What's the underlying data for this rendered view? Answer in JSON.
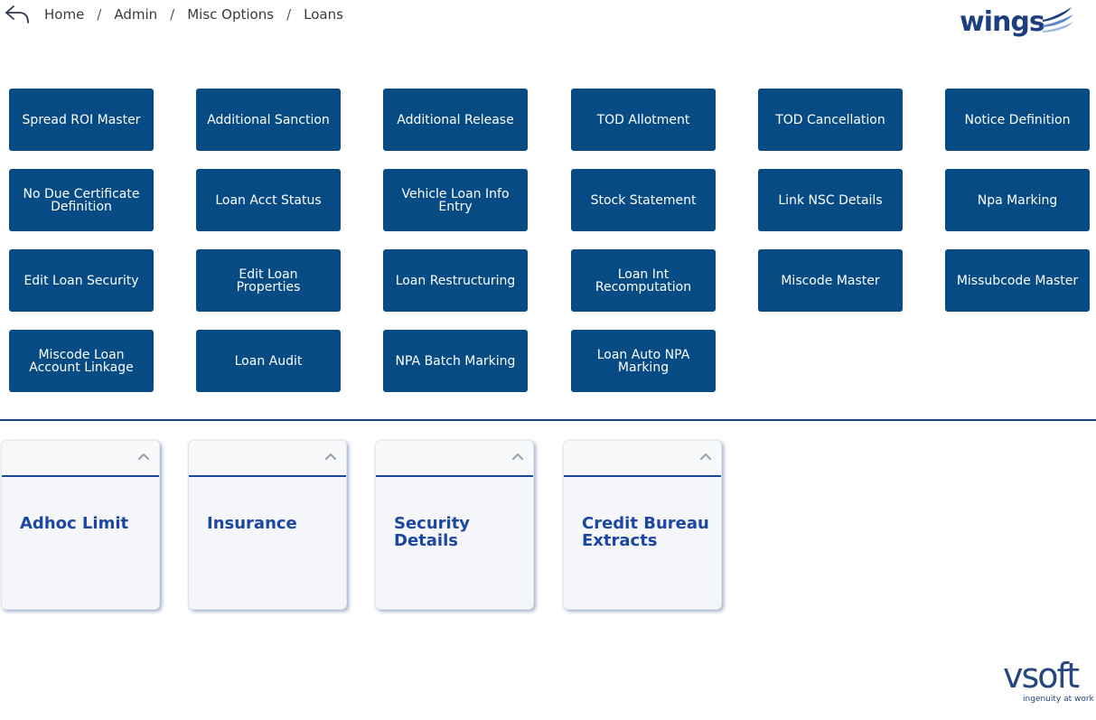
{
  "breadcrumb": [
    "Home",
    "Admin",
    "Misc Options",
    "Loans"
  ],
  "brand": {
    "logo": "wings",
    "footer_logo": "vsoft",
    "footer_tagline": "ingenuity at work"
  },
  "colors": {
    "tile": "#064b84",
    "card_title": "#1c47a0",
    "divider": "#1b3f78",
    "brand": "#1e3f7f"
  },
  "icons": {
    "back": "back-arrow-icon",
    "collapse": "chevron-up-icon"
  },
  "tiles": [
    "Spread ROI Master",
    "Additional Sanction",
    "Additional Release",
    "TOD Allotment",
    "TOD Cancellation",
    "Notice Definition",
    "No Due Certificate Definition",
    "Loan Acct Status",
    "Vehicle Loan Info Entry",
    "Stock Statement",
    "Link NSC Details",
    "Npa Marking",
    "Edit Loan Security",
    "Edit Loan Properties",
    "Loan Restructuring",
    "Loan Int Recomputation",
    "Miscode Master",
    "Missubcode Master",
    "Miscode Loan Account Linkage",
    "Loan Audit",
    "NPA Batch Marking",
    "Loan Auto NPA Marking"
  ],
  "cards": [
    "Adhoc Limit",
    "Insurance",
    "Security Details",
    "Credit Bureau Extracts"
  ]
}
